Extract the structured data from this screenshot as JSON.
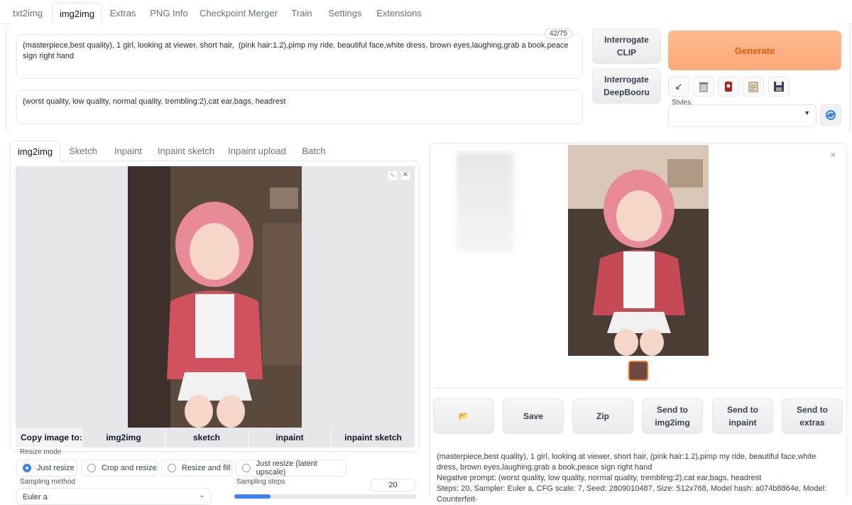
{
  "tabs": [
    "txt2img",
    "img2img",
    "Extras",
    "PNG Info",
    "Checkpoint Merger",
    "Train",
    "Settings",
    "Extensions"
  ],
  "prompt": {
    "value": "(masterpiece,best quality), 1 girl, looking at viewer, short hair,  (pink hair:1.2),pimp my ride, beautiful face,white dress, brown eyes,laughing,grab a book,peace sign right hand",
    "token_count": "42/75"
  },
  "negative_prompt": {
    "value": "(worst quality, low quality, normal quality, trembling:2),cat ear,bags, headrest"
  },
  "buttons": {
    "interrogate_clip": "Interrogate CLIP",
    "interrogate_deepbooru": "Interrogate DeepBooru",
    "generate": "Generate"
  },
  "tools": [
    "arrow-icon",
    "trash-icon",
    "red-card-icon",
    "clipboard-icon",
    "save-icon"
  ],
  "styles": {
    "label": "Styles",
    "value": ""
  },
  "subtabs": [
    "img2img",
    "Sketch",
    "Inpaint",
    "Inpaint sketch",
    "Inpaint upload",
    "Batch"
  ],
  "copy": {
    "label": "Copy image to:",
    "targets": [
      "img2img",
      "sketch",
      "inpaint",
      "inpaint sketch"
    ]
  },
  "resize": {
    "label": "Resize mode",
    "options": [
      "Just resize",
      "Crop and resize",
      "Resize and fill",
      "Just resize (latent upscale)"
    ],
    "selected": "Just resize"
  },
  "sampling": {
    "method_label": "Sampling method",
    "method_value": "Euler a",
    "steps_label": "Sampling steps",
    "steps_value": "20",
    "steps_fraction": 0.2
  },
  "output_buttons": [
    "Save",
    "Zip",
    "Send to img2img",
    "Send to inpaint",
    "Send to extras"
  ],
  "generation_info": {
    "line1": "(masterpiece,best quality), 1 girl, looking at viewer, short hair, (pink hair:1.2),pimp my ride, beautiful face,white dress, brown eyes,laughing,grab a book,peace sign right hand",
    "line2": "Negative prompt: (worst quality, low quality, normal quality, trembling:2),cat ear,bags, headrest",
    "line3": "Steps: 20, Sampler: Euler a, CFG scale: 7, Seed: 2809010487, Size: 512x768, Model hash: a074b8864e, Model: Counterfeit-"
  },
  "colors": {
    "accent": "#f97316",
    "radio": "#3b82f6",
    "generate_bg": "#fdba8c"
  }
}
